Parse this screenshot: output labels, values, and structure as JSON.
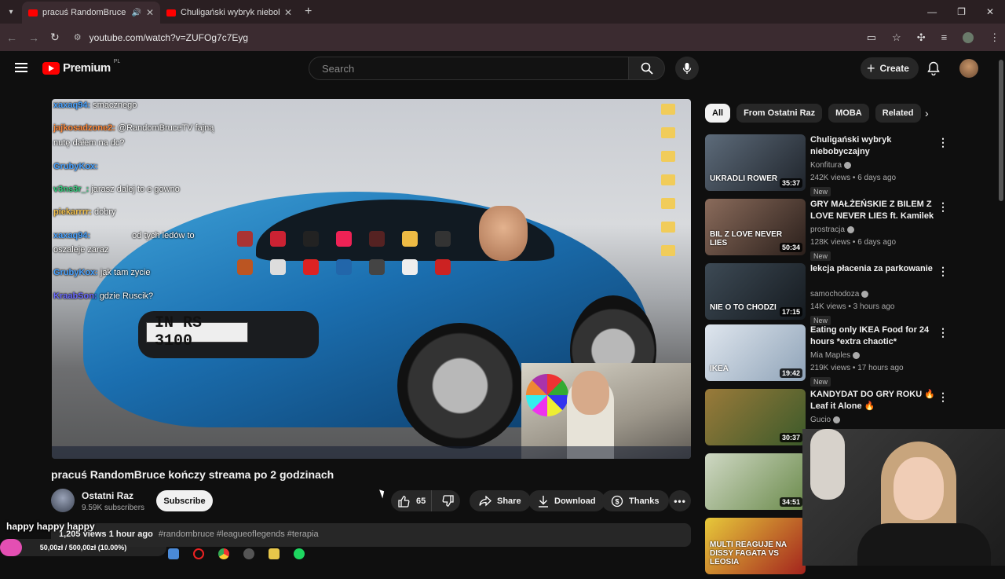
{
  "browser": {
    "tabs": [
      {
        "title": "pracuś RandomBruce kończy s",
        "active": true
      },
      {
        "title": "Chuligański wybryk niebobyczajny",
        "active": false
      }
    ],
    "url": "youtube.com/watch?v=ZUFOg7c7Eyg"
  },
  "header": {
    "logo_text": "Premium",
    "country": "PL",
    "search_placeholder": "Search",
    "create_label": "Create"
  },
  "video": {
    "plate": "IN RS 3100",
    "chat": [
      {
        "user": "xaxaq94:",
        "text": "smacznego",
        "color": "#4aa3ff"
      },
      {
        "user": "jajkosadzone2:",
        "text": "@RandomBruceTV fajną",
        "color": "#ff8a3c"
      },
      {
        "user": "",
        "text": "nutę dałem na dc?",
        "color": "#ffffff"
      },
      {
        "user": "GrubyKox:",
        "text": "",
        "color": "#4aa3ff"
      },
      {
        "user": "v3ns3r_:",
        "text": "jarasz dalej to e gowno",
        "color": "#35d07f"
      },
      {
        "user": "piekarrrr:",
        "text": "dobry",
        "color": "#f2c14e"
      },
      {
        "user": "xaxaq94:",
        "text": "od tych ledów to",
        "color": "#4aa3ff"
      },
      {
        "user": "",
        "text": "oszaleje zaraz",
        "color": "#ffffff"
      },
      {
        "user": "GrubyKox:",
        "text": "jak tam zycie",
        "color": "#4aa3ff"
      },
      {
        "user": "KraabSon:",
        "text": "gdzie Ruscik?",
        "color": "#6b6bff"
      }
    ]
  },
  "meta": {
    "title": "pracuś RandomBruce kończy streama po 2 godzinach",
    "channel": "Ostatni Raz",
    "subscribers": "9.59K subscribers",
    "subscribe_label": "Subscribe",
    "likes": "65",
    "share_label": "Share",
    "download_label": "Download",
    "thanks_label": "Thanks",
    "views_time": "1,205 views  1 hour ago",
    "tags": "#randombruce #leagueoflegends #terapia"
  },
  "overlay": {
    "text": "happy happy happy",
    "donation_label": "50,00zł / 500,00zł (10.00%)",
    "donation_progress": 0.1
  },
  "sidebar": {
    "chips": [
      "All",
      "From Ostatni Raz",
      "MOBA",
      "Related"
    ],
    "recs": [
      {
        "title": "Chuligański wybryk niebobyczajny",
        "channel": "Konfitura",
        "meta": "242K views • 6 days ago",
        "duration": "35:37",
        "new": "New",
        "thumb_text": "UKRADLI ROWER",
        "c1": "#5d6b7a",
        "c2": "#1f242b"
      },
      {
        "title": "GRY MAŁŻEŃSKIE Z BILEM Z LOVE NEVER LIES ft. Kamilek",
        "channel": "prostracja",
        "meta": "128K views • 6 days ago",
        "duration": "50:34",
        "new": "New",
        "thumb_text": "BIL Z LOVE NEVER LIES",
        "c1": "#8a6b5b",
        "c2": "#2a1f1b"
      },
      {
        "title": "lekcja płacenia za parkowanie",
        "channel": "samochodoza",
        "meta": "14K views • 3 hours ago",
        "duration": "17:15",
        "new": "New",
        "thumb_text": "NIE O TO CHODZI",
        "c1": "#3d4a55",
        "c2": "#151a1f"
      },
      {
        "title": "Eating only IKEA Food for 24 hours *extra chaotic*",
        "channel": "Mia Maples",
        "meta": "219K views • 17 hours ago",
        "duration": "19:42",
        "new": "New",
        "thumb_text": "IKEA",
        "c1": "#dfe6ee",
        "c2": "#8fa3b8"
      },
      {
        "title": "KANDYDAT DO GRY ROKU 🔥 Leaf it Alone 🔥",
        "channel": "Gucio",
        "meta": "",
        "duration": "30:37",
        "new": "",
        "thumb_text": "",
        "c1": "#9a7a3a",
        "c2": "#3b5a2a"
      },
      {
        "title": "",
        "channel": "",
        "meta": "",
        "duration": "34:51",
        "new": "",
        "thumb_text": "",
        "c1": "#cfd8c4",
        "c2": "#6a8a4a"
      },
      {
        "title": "",
        "channel": "",
        "meta": "",
        "duration": "",
        "new": "",
        "thumb_text": "MULTI REAGUJE NA DISSY FAGATA VS LEOSIA",
        "c1": "#e7c93a",
        "c2": "#a3221d"
      }
    ]
  }
}
